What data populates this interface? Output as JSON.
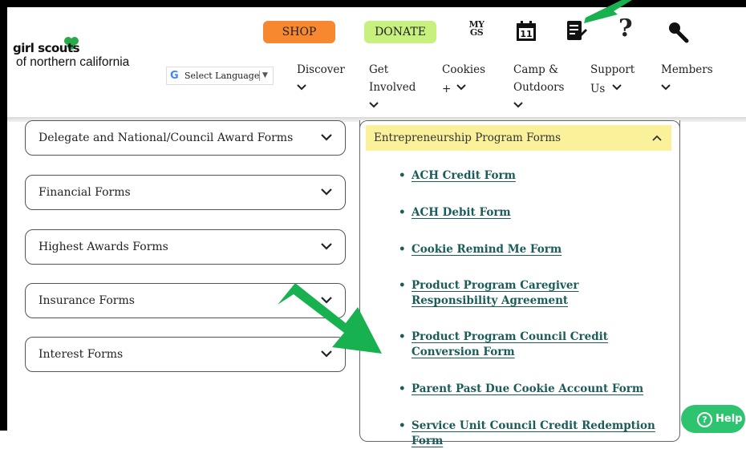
{
  "header": {
    "logo": {
      "line1": "girl scouts",
      "line2": "of northern california"
    },
    "shop_label": "SHOP",
    "donate_label": "DONATE",
    "mygs_label": "MY GS",
    "help_icon_char": "?",
    "language": {
      "g": "G",
      "label": "Select Language",
      "arrow": "▼"
    },
    "nav": [
      {
        "label": "Discover"
      },
      {
        "label": "Get Involved"
      },
      {
        "label": "Cookies +"
      },
      {
        "label": "Camp & Outdoors"
      },
      {
        "label": "Support Us"
      },
      {
        "label": "Members"
      }
    ]
  },
  "accordions": [
    {
      "label": "Delegate and National/Council Award Forms"
    },
    {
      "label": "Financial Forms"
    },
    {
      "label": "Highest Awards Forms"
    },
    {
      "label": "Insurance Forms"
    },
    {
      "label": "Interest Forms"
    }
  ],
  "panel": {
    "title": "Entrepreneurship Program Forms",
    "links": [
      {
        "label": "ACH Credit Form"
      },
      {
        "label": "ACH Debit Form"
      },
      {
        "label": "Cookie Remind Me Form"
      },
      {
        "label": "Product Program Caregiver Responsibility Agreement"
      },
      {
        "label": "Product Program Council Credit Conversion Form"
      },
      {
        "label": "Parent Past Due Cookie Account Form"
      },
      {
        "label": "Service Unit Council Credit Redemption Form"
      }
    ]
  },
  "help_button": {
    "label": "Help",
    "icon": "?"
  },
  "colors": {
    "shop": "#f7882f",
    "donate": "#c8f07e",
    "panel_header": "#fbf19a",
    "link": "#1a5c5a",
    "arrow": "#17b14f",
    "help": "#2ec46f"
  }
}
